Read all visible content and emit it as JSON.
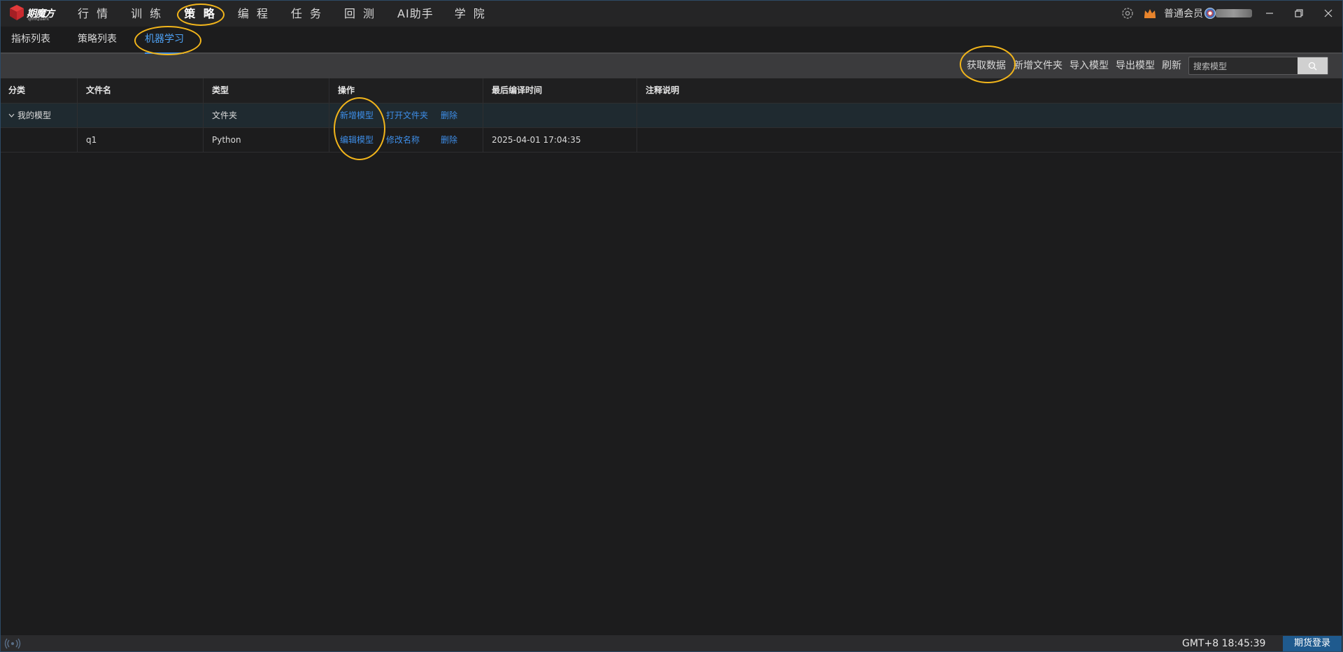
{
  "app": {
    "logo_name": "期魔方",
    "logo_sub": "qmfQuant"
  },
  "main_nav": [
    {
      "label": "行 情"
    },
    {
      "label": "训 练"
    },
    {
      "label": "策 略"
    },
    {
      "label": "编 程"
    },
    {
      "label": "任 务"
    },
    {
      "label": "回 测"
    },
    {
      "label": "AI助手"
    },
    {
      "label": "学 院"
    }
  ],
  "header": {
    "member_label": "普通会员"
  },
  "sub_tabs": [
    {
      "label": "指标列表"
    },
    {
      "label": "策略列表"
    },
    {
      "label": "机器学习"
    }
  ],
  "toolbar": {
    "fetch_data": "获取数据",
    "new_folder": "新增文件夹",
    "import_model": "导入模型",
    "export_model": "导出模型",
    "refresh": "刷新",
    "search_placeholder": "搜索模型"
  },
  "table": {
    "columns": [
      "分类",
      "文件名",
      "类型",
      "操作",
      "最后编译时间",
      "注释说明"
    ],
    "rows": [
      {
        "category": "我的模型",
        "filename": "",
        "type": "文件夹",
        "actions": [
          "新增模型",
          "打开文件夹",
          "删除"
        ],
        "compiled": "",
        "note": ""
      },
      {
        "category": "",
        "filename": "q1",
        "type": "Python",
        "actions": [
          "编辑模型",
          "修改名称",
          "删除"
        ],
        "compiled": "2025-04-01 17:04:35",
        "note": ""
      }
    ]
  },
  "status": {
    "time": "GMT+8 18:45:39",
    "login": "期货登录"
  },
  "colors": {
    "accent": "#3e8ee8",
    "highlight": "#f2b51b",
    "background": "#1c1c1d"
  }
}
